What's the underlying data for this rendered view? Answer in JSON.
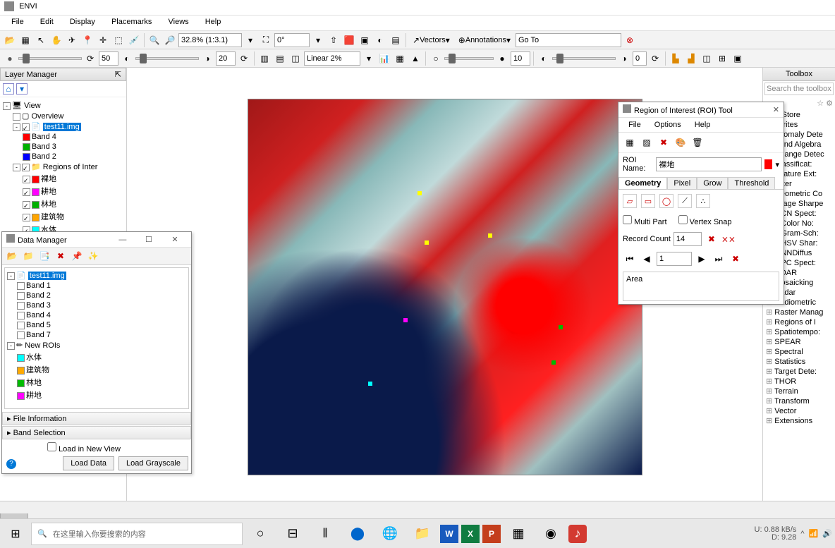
{
  "app": {
    "title": "ENVI"
  },
  "menubar": [
    "File",
    "Edit",
    "Display",
    "Placemarks",
    "Views",
    "Help"
  ],
  "toolbar1": {
    "zoom": "32.8% (1:3.1)",
    "rotation": "0°",
    "vectors": "Vectors",
    "annotations": "Annotations",
    "goto": "Go To"
  },
  "toolbar2": {
    "val1": "50",
    "val2": "20",
    "stretch": "Linear 2%",
    "val3": "10",
    "val4": "0"
  },
  "layer_panel": {
    "title": "Layer Manager",
    "view": "View",
    "overview": "Overview",
    "image": "test11.img",
    "bands": [
      "Band 4",
      "Band 3",
      "Band 2"
    ],
    "band_colors": [
      "#ff0000",
      "#00b000",
      "#0000ff"
    ],
    "roi_folder": "Regions of Inter",
    "rois": [
      "裸地",
      "耕地",
      "林地",
      "建筑物",
      "水体"
    ],
    "roi_colors": [
      "#ff0000",
      "#ff00ff",
      "#00b000",
      "#ffa500",
      "#00ffff"
    ]
  },
  "data_manager": {
    "title": "Data Manager",
    "image": "test11.img",
    "bands": [
      "Band 1",
      "Band 2",
      "Band 3",
      "Band 4",
      "Band 5",
      "Band 7"
    ],
    "roi_folder": "New ROIs",
    "rois": [
      "水体",
      "建筑物",
      "林地",
      "耕地"
    ],
    "sect1": "File Information",
    "sect2": "Band Selection",
    "load_new": "Load in New View",
    "btn_load": "Load Data",
    "btn_gray": "Load Grayscale"
  },
  "roi_tool": {
    "title": "Region of Interest (ROI) Tool",
    "menu": [
      "File",
      "Options",
      "Help"
    ],
    "name_label": "ROI Name:",
    "name_value": "裸地",
    "tabs": [
      "Geometry",
      "Pixel",
      "Grow",
      "Threshold"
    ],
    "multi_part": "Multi Part",
    "vertex_snap": "Vertex Snap",
    "record_label": "Record Count",
    "record_count": "14",
    "record_idx": "1",
    "area_label": "Area"
  },
  "toolbox": {
    "title": "Toolbox",
    "search_ph": "Search the toolbox",
    "items_top": [
      "App Store",
      "Favorites",
      "Anomaly Dete",
      "Band Algebra",
      "Change Detec",
      "Classificat:",
      "Feature Ext:",
      "Filter",
      "Geometric Co",
      "Image Sharpe"
    ],
    "items_sub": [
      "CN Spect:",
      "Color No:",
      "Gram-Sch:",
      "HSV Shar:",
      "NNDiffus",
      "PC Spect:"
    ],
    "items_bot": [
      "LiDAR",
      "Mosaicking",
      "Radar",
      "Radiometric",
      "Raster Manag",
      "Regions of I",
      "Spatiotempo:",
      "SPEAR",
      "Spectral",
      "Statistics",
      "Target Dete:",
      "THOR",
      "Terrain",
      "Transform",
      "Vector",
      "Extensions"
    ]
  },
  "taskbar": {
    "search_ph": "在这里输入你要搜索的内容",
    "net_up": "0.88 kB/s",
    "net_dn": "9.28"
  }
}
